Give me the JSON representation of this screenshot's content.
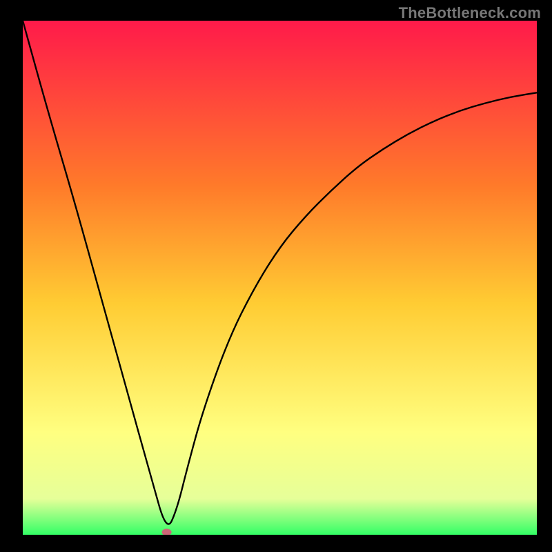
{
  "watermark": "TheBottleneck.com",
  "colors": {
    "gradient_top": "#ff1a4a",
    "gradient_mid1": "#ff7a2a",
    "gradient_mid2": "#ffcc33",
    "gradient_mid3": "#ffff66",
    "gradient_bottom": "#33ff66",
    "curve": "#000000",
    "marker": "#cc6677",
    "frame_bg": "#000000"
  },
  "chart_data": {
    "type": "line",
    "title": "",
    "xlabel": "",
    "ylabel": "",
    "xlim": [
      0,
      100
    ],
    "ylim": [
      0,
      100
    ],
    "grid": false,
    "legend": false,
    "note": "V-shaped bottleneck curve. Left branch is a straight diagonal descending from the top-left corner to the minimum; right branch rises with diminishing slope toward the right edge. Minimum (zero bottleneck) marked by a small pinkish dot near the bottom.",
    "series": [
      {
        "name": "bottleneck_percent",
        "x": [
          0,
          5,
          10,
          15,
          20,
          25,
          28,
          30,
          32,
          35,
          40,
          45,
          50,
          55,
          60,
          65,
          70,
          75,
          80,
          85,
          90,
          95,
          100
        ],
        "y": [
          100,
          82,
          65,
          47,
          29,
          11,
          0.5,
          5,
          13,
          24,
          38,
          48,
          56,
          62,
          67,
          71.5,
          75,
          78,
          80.5,
          82.5,
          84,
          85.2,
          86
        ]
      }
    ],
    "minimum_marker": {
      "x": 28,
      "y": 0.5
    },
    "background_gradient_stops": [
      {
        "offset": 0.0,
        "color": "#ff1a4a"
      },
      {
        "offset": 0.32,
        "color": "#ff7a2a"
      },
      {
        "offset": 0.55,
        "color": "#ffcc33"
      },
      {
        "offset": 0.8,
        "color": "#ffff80"
      },
      {
        "offset": 0.93,
        "color": "#e6ff99"
      },
      {
        "offset": 1.0,
        "color": "#33ff66"
      }
    ]
  }
}
